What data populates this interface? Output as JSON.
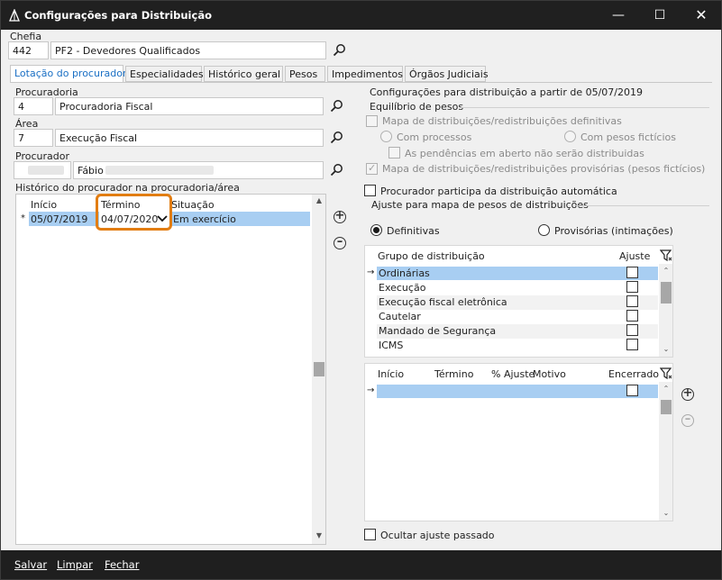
{
  "window": {
    "title": "Configurações para Distribuição"
  },
  "chefia": {
    "label": "Chefia",
    "code": "442",
    "name": "PF2 - Devedores Qualificados"
  },
  "tabs": [
    {
      "label": "Lotação do procurador"
    },
    {
      "label": "Especialidades"
    },
    {
      "label": "Histórico geral"
    },
    {
      "label": "Pesos"
    },
    {
      "label": "Impedimentos"
    },
    {
      "label": "Órgãos Judiciais"
    }
  ],
  "procuradoria": {
    "label": "Procuradoria",
    "code": "4",
    "name": "Procuradoria Fiscal"
  },
  "area": {
    "label": "Área",
    "code": "7",
    "name": "Execução Fiscal"
  },
  "procurador": {
    "label": "Procurador",
    "code": "",
    "name": "Fábio"
  },
  "historico": {
    "label": "Histórico do procurador na procuradoria/área",
    "columns": [
      "Início",
      "Término",
      "Situação"
    ],
    "rows": [
      {
        "marker": "*",
        "inicio": "05/07/2019",
        "termino": "04/07/2020",
        "situacao": "Em exercício"
      }
    ]
  },
  "config": {
    "heading": "Configurações para distribuição a partir de 05/07/2019",
    "equilibrio_label": "Equilíbrio de pesos",
    "mapa_definitivas": "Mapa de distribuições/redistribuições definitivas",
    "com_processos": "Com processos",
    "com_pesos_ficticios": "Com pesos fictícios",
    "pendencias": "As pendências em aberto não serão distribuidas",
    "mapa_provisorias": "Mapa de distribuições/redistribuições provisórias (pesos fictícios)",
    "participa": "Procurador participa da distribuição automática",
    "ajuste_label": "Ajuste para mapa de pesos de distribuições",
    "definitivas": "Definitivas",
    "provisorias": "Provisórias (intimações)"
  },
  "grupos": {
    "columns": [
      "Grupo de distribuição",
      "Ajuste"
    ],
    "rows": [
      {
        "name": "Ordinárias"
      },
      {
        "name": "Execução"
      },
      {
        "name": "Execução fiscal eletrônica"
      },
      {
        "name": "Cautelar"
      },
      {
        "name": "Mandado de Segurança"
      },
      {
        "name": "ICMS"
      }
    ]
  },
  "ajustes": {
    "columns": [
      "Início",
      "Término",
      "% Ajuste",
      "Motivo",
      "Encerrado"
    ]
  },
  "ocultar": "Ocultar ajuste passado",
  "menu": {
    "salvar": "Salvar",
    "limpar": "Limpar",
    "fechar": "Fechar"
  }
}
